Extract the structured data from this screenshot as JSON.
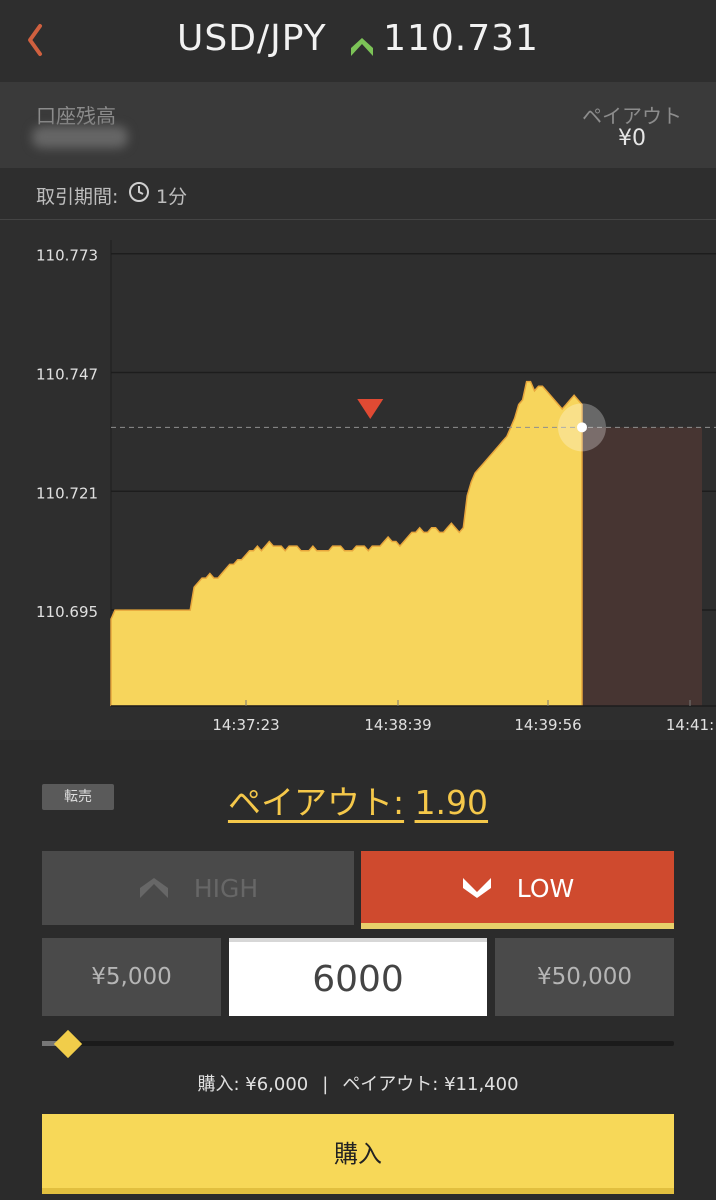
{
  "header": {
    "pair": "USD/JPY",
    "price": "110.731",
    "colors": {
      "back": "#d0603f",
      "up_arrow": "#7cc357"
    }
  },
  "account": {
    "balance_label": "口座残高",
    "payout_label": "ペイアウト",
    "payout_value": "¥0"
  },
  "period": {
    "label": "取引期間:",
    "value": "1分"
  },
  "chart_data": {
    "type": "area",
    "y_ticks": [
      "110.773",
      "110.747",
      "110.721",
      "110.695"
    ],
    "x_ticks": [
      "14:37:23",
      "14:38:39",
      "14:39:56",
      "14:41:"
    ],
    "ylim": [
      110.674,
      110.776
    ],
    "x": [
      0,
      2,
      4,
      6,
      8,
      10,
      12,
      14,
      16,
      18,
      20,
      22,
      24,
      26,
      28,
      30,
      32,
      34,
      36,
      38,
      40,
      42,
      44,
      46,
      48,
      50,
      52,
      54,
      56,
      58,
      60,
      62,
      64,
      66,
      68,
      70,
      72,
      74,
      76,
      78,
      80,
      82,
      84,
      86,
      88,
      90,
      92,
      94,
      96,
      98,
      100,
      102,
      104,
      106,
      108,
      110,
      112,
      114,
      116,
      118,
      120,
      122,
      124,
      126,
      128,
      130,
      132,
      134,
      136,
      138,
      140,
      142,
      144,
      146,
      148,
      150,
      152,
      154,
      156,
      158,
      160,
      162,
      164,
      166,
      168,
      170,
      172,
      174,
      176,
      178,
      180,
      182,
      184,
      186,
      188,
      190,
      192,
      194,
      196,
      198,
      200,
      202,
      204,
      206,
      208,
      210,
      212,
      214,
      216,
      218,
      220,
      222,
      224,
      226,
      228,
      230,
      232,
      234,
      236,
      238
    ],
    "values": [
      110.693,
      110.695,
      110.695,
      110.695,
      110.695,
      110.695,
      110.695,
      110.695,
      110.695,
      110.695,
      110.695,
      110.695,
      110.695,
      110.695,
      110.695,
      110.695,
      110.695,
      110.695,
      110.695,
      110.695,
      110.695,
      110.7,
      110.701,
      110.702,
      110.702,
      110.703,
      110.702,
      110.702,
      110.703,
      110.704,
      110.705,
      110.705,
      110.706,
      110.706,
      110.707,
      110.708,
      110.708,
      110.709,
      110.708,
      110.709,
      110.71,
      110.709,
      110.709,
      110.709,
      110.708,
      110.709,
      110.709,
      110.709,
      110.708,
      110.708,
      110.708,
      110.709,
      110.708,
      110.708,
      110.708,
      110.708,
      110.709,
      110.709,
      110.709,
      110.708,
      110.708,
      110.708,
      110.709,
      110.709,
      110.709,
      110.708,
      110.709,
      110.709,
      110.709,
      110.71,
      110.711,
      110.71,
      110.71,
      110.709,
      110.71,
      110.711,
      110.712,
      110.712,
      110.713,
      110.712,
      110.712,
      110.713,
      110.713,
      110.712,
      110.712,
      110.713,
      110.714,
      110.713,
      110.712,
      110.713,
      110.72,
      110.723,
      110.725,
      110.726,
      110.727,
      110.728,
      110.729,
      110.73,
      110.731,
      110.732,
      110.733,
      110.735,
      110.737,
      110.74,
      110.741,
      110.745,
      110.745,
      110.743,
      110.744,
      110.744,
      110.743,
      110.742,
      110.741,
      110.74,
      110.739,
      110.74,
      110.741,
      110.742,
      110.741,
      110.74,
      110.739,
      110.74,
      110.741,
      110.742,
      110.741,
      110.74,
      110.739,
      110.739,
      110.74,
      110.741,
      110.742,
      110.741,
      110.74,
      110.739,
      110.738,
      110.737,
      110.737,
      110.735,
      110.736,
      110.735,
      110.736,
      110.734,
      110.735,
      110.733,
      110.734,
      110.732,
      110.731,
      110.732,
      110.73,
      110.731,
      110.729,
      110.728,
      110.728,
      110.728,
      110.728,
      110.728,
      110.728,
      110.728,
      110.729,
      110.73,
      110.731,
      110.73,
      110.731,
      110.732,
      110.733,
      110.734,
      110.735,
      110.736,
      110.737,
      110.736,
      110.737,
      110.737,
      110.736,
      110.737,
      110.736,
      110.735,
      110.734,
      110.733,
      110.734,
      110.733,
      110.732,
      110.731,
      110.731
    ],
    "entry_marker": {
      "x": 131,
      "value": 110.739,
      "direction": "low"
    },
    "current_price": 110.735
  },
  "trade": {
    "resale_label": "転売",
    "payout_prefix": "ペイアウト:",
    "payout_rate": "1.90",
    "high_label": "HIGH",
    "low_label": "LOW",
    "preset_low": "¥5,000",
    "amount": "6000",
    "preset_high": "¥50,000",
    "slider_value": 6000,
    "purchase_label": "購入: ¥6,000",
    "payout_summary": "ペイアウト: ¥11,400",
    "separator": "|",
    "buy_label": "購入",
    "colors": {
      "low_selected": "#cf4a2e",
      "accent_yellow": "#f7d858"
    }
  }
}
